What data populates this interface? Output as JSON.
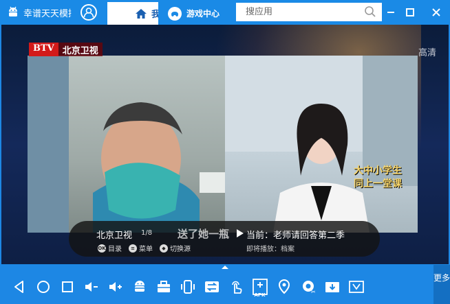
{
  "app": {
    "title": "幸谱天天模拟器"
  },
  "tabs": [
    {
      "label": "我的游戏"
    },
    {
      "label": "游戏中心"
    }
  ],
  "search": {
    "placeholder": "搜应用"
  },
  "window": {
    "minimize": "minimize",
    "maximize": "maximize",
    "close": "close"
  },
  "video": {
    "channel_logo": "BTV",
    "channel_name": "北京卫视",
    "quality": "高清",
    "banner": [
      "大中小学生",
      "同上一堂课"
    ],
    "subtitle": "送了她一瓶"
  },
  "player": {
    "channel": "北京卫视",
    "index": "1/8",
    "actions": [
      {
        "icon": "OK",
        "label": "目录"
      },
      {
        "icon": "≡",
        "label": "菜单"
      },
      {
        "icon": "◆",
        "label": "切换源"
      }
    ],
    "now_playing": "当前：老师请回答第二季",
    "up_next": "即将播放：档案"
  },
  "toolbar": {
    "more": "更多",
    "items": [
      {
        "icon": "back-icon"
      },
      {
        "icon": "home-icon"
      },
      {
        "icon": "recent-apps-icon"
      },
      {
        "icon": "volume-down-icon"
      },
      {
        "icon": "volume-up-icon"
      },
      {
        "icon": "android-icon"
      },
      {
        "icon": "toolbox-icon"
      },
      {
        "icon": "shake-icon"
      },
      {
        "icon": "switch-icon"
      },
      {
        "icon": "touch-icon"
      },
      {
        "icon": "apk-install-icon",
        "label": "APK"
      },
      {
        "icon": "location-icon"
      },
      {
        "icon": "screenshot-icon"
      },
      {
        "icon": "download-icon"
      },
      {
        "icon": "scissors-icon"
      }
    ]
  },
  "colors": {
    "primary": "#1d87e4",
    "tab_bg": "#ffffff",
    "tab_text": "#1a5fb0",
    "accent_red": "#d31a1a"
  }
}
